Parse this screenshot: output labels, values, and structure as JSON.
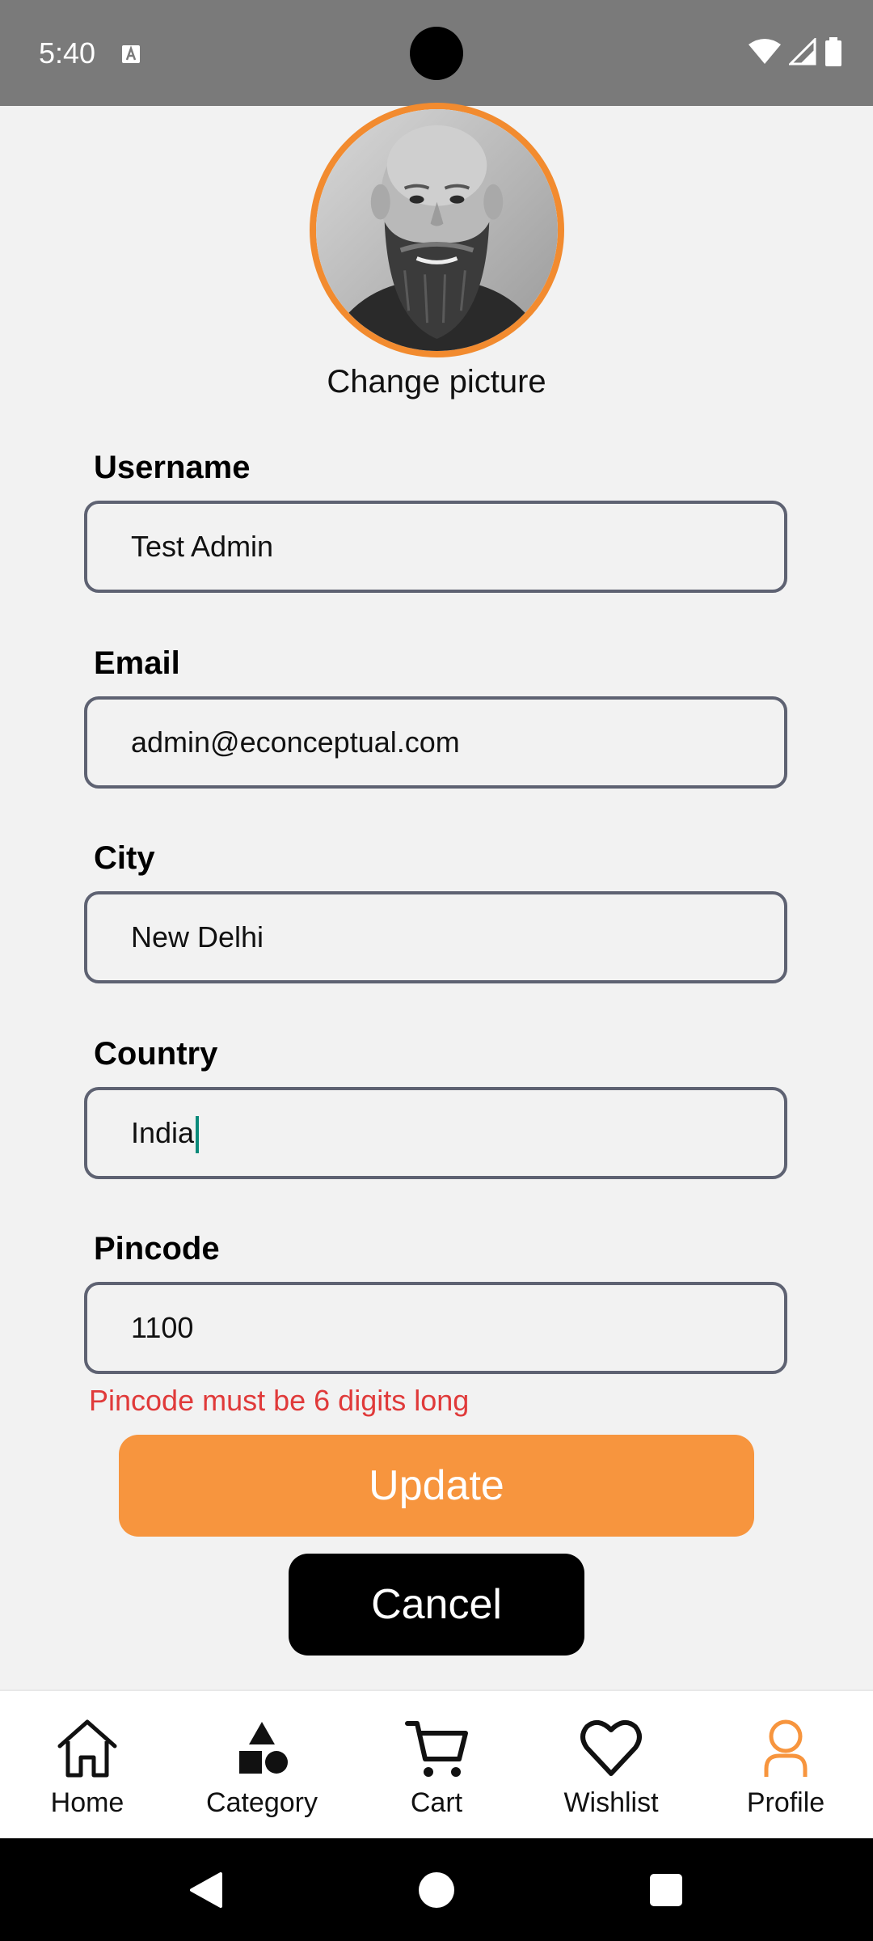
{
  "status": {
    "time": "5:40"
  },
  "profile": {
    "change_picture_label": "Change picture"
  },
  "form": {
    "username": {
      "label": "Username",
      "value": "Test Admin"
    },
    "email": {
      "label": "Email",
      "value": "admin@econceptual.com"
    },
    "city": {
      "label": "City",
      "value": "New Delhi"
    },
    "country": {
      "label": "Country",
      "value": "India"
    },
    "pincode": {
      "label": "Pincode",
      "value": "1100"
    },
    "pincode_error": "Pincode must be 6 digits long"
  },
  "actions": {
    "update_label": "Update",
    "cancel_label": "Cancel"
  },
  "nav": {
    "items": [
      {
        "label": "Home",
        "icon": "home-icon"
      },
      {
        "label": "Category",
        "icon": "category-icon"
      },
      {
        "label": "Cart",
        "icon": "cart-icon"
      },
      {
        "label": "Wishlist",
        "icon": "heart-icon"
      },
      {
        "label": "Profile",
        "icon": "person-icon",
        "active": true
      }
    ]
  },
  "colors": {
    "accent": "#f7953e",
    "avatar_ring": "#f28b2f",
    "error": "#e03a3a",
    "field_border": "#5e6272",
    "status_bar": "#7a7a7a"
  }
}
